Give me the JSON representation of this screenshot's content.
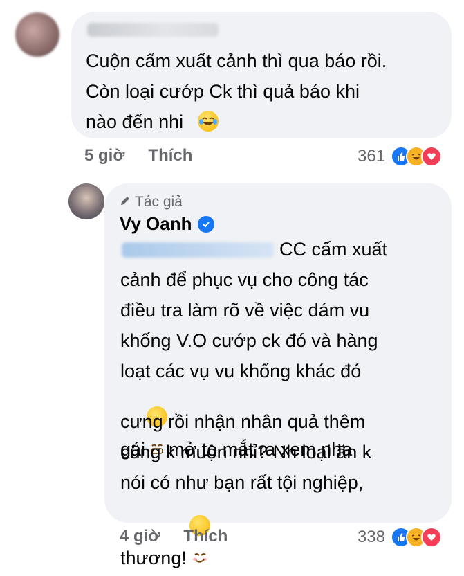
{
  "comment1": {
    "text": "Cuộn cấm xuất cảnh thì qua báo rồi.\nCòn loại cướp Ck thì quả báo khi\nnào đến nhi",
    "time": "5 giờ",
    "like_label": "Thích",
    "reaction_count": "361",
    "reactions": [
      "like-icon",
      "haha-icon",
      "love-icon"
    ]
  },
  "reply": {
    "author_tag": "Tác giả",
    "author_name": "Vy Oanh",
    "text_line1": "CC cấm xuất",
    "text_rest": "cảnh để phục vụ cho công tác\nđiều tra làm rõ về việc dám vu\nkhống V.O cướp ck đó và hàng\nloạt các vụ vu khống khác đó",
    "text_gai_a": "gái",
    "text_gai_b": "mở to mắt ra xem nha",
    "text_after": "cưng rồi nhận nhân quả thêm\ncũng k muộn nhỉ? Nh loại ăn k\nnói có như bạn rất tội nghiệp,",
    "text_last": "thương!",
    "time": "4 giờ",
    "like_label": "Thích",
    "reaction_count": "338",
    "reactions": [
      "like-icon",
      "haha-icon",
      "love-icon"
    ]
  },
  "colors": {
    "bubble": "#f0f2f5",
    "like": "#1877f2",
    "love": "#f33e58",
    "haha": "#f7b125",
    "meta": "#65676b"
  }
}
